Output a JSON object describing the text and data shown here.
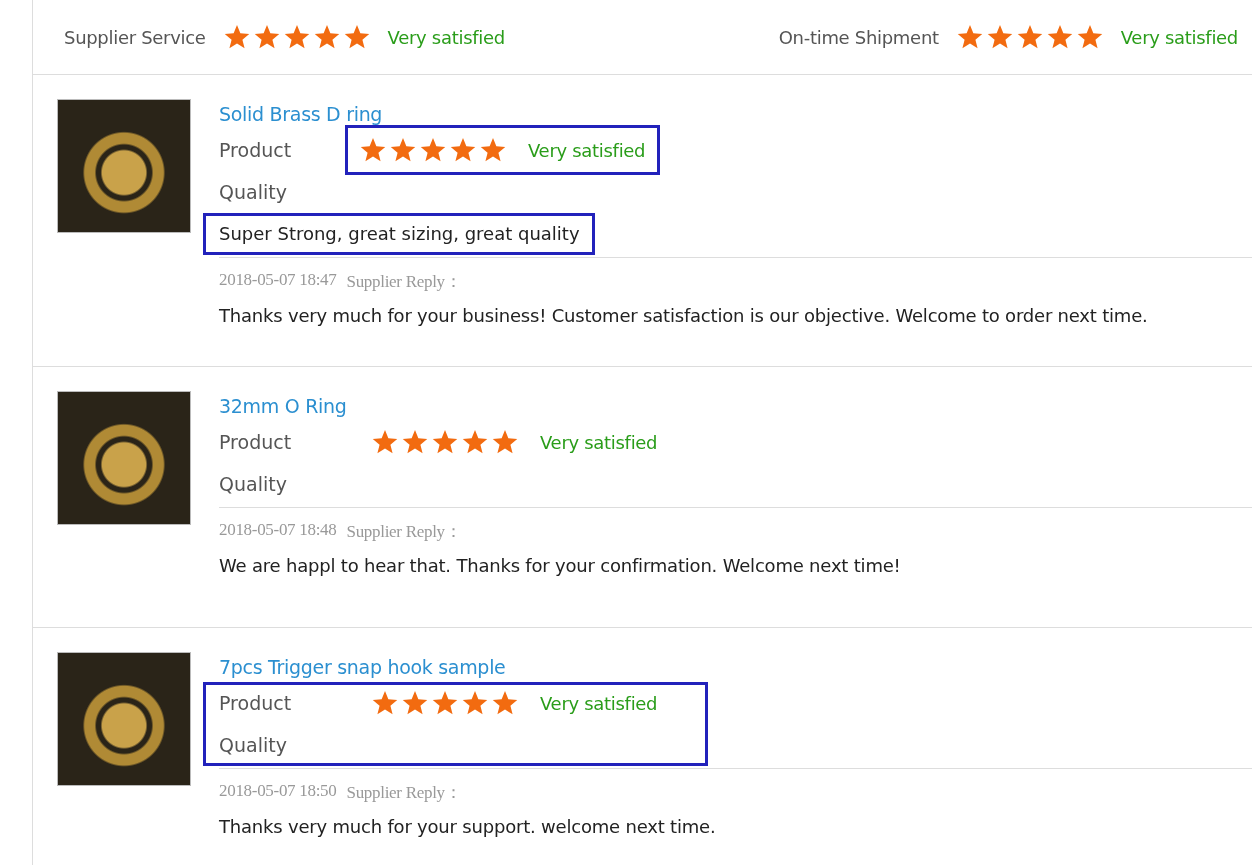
{
  "summary": [
    {
      "label": "Supplier Service",
      "stars": 5,
      "verdict": "Very satisfied"
    },
    {
      "label": "On-time Shipment",
      "stars": 5,
      "verdict": "Very satisfied"
    }
  ],
  "reviews": [
    {
      "title": "Solid Brass D ring",
      "rating_label": "Product",
      "rating_sublabel": "Quality",
      "stars": 5,
      "verdict": "Very satisfied",
      "comment": "Super Strong, great sizing, great quality",
      "highlight_rating": true,
      "highlight_comment": true,
      "highlight_block": false,
      "reply_time": "2018-05-07 18:47",
      "reply_label": "Supplier Reply：",
      "reply": "Thanks very much for your business! Customer satisfaction is our objective. Welcome to order next time."
    },
    {
      "title": "32mm O Ring",
      "rating_label": "Product",
      "rating_sublabel": "Quality",
      "stars": 5,
      "verdict": "Very satisfied",
      "highlight_rating": false,
      "highlight_block": false,
      "reply_time": "2018-05-07 18:48",
      "reply_label": "Supplier Reply：",
      "reply": "We are happl to hear that. Thanks for your confirmation. Welcome next time!"
    },
    {
      "title": "7pcs Trigger snap hook sample",
      "rating_label": "Product",
      "rating_sublabel": "Quality",
      "stars": 5,
      "verdict": "Very satisfied",
      "highlight_rating": false,
      "highlight_block": true,
      "reply_time": "2018-05-07 18:50",
      "reply_label": "Supplier Reply：",
      "reply": "Thanks very much for your support. welcome next time."
    }
  ]
}
